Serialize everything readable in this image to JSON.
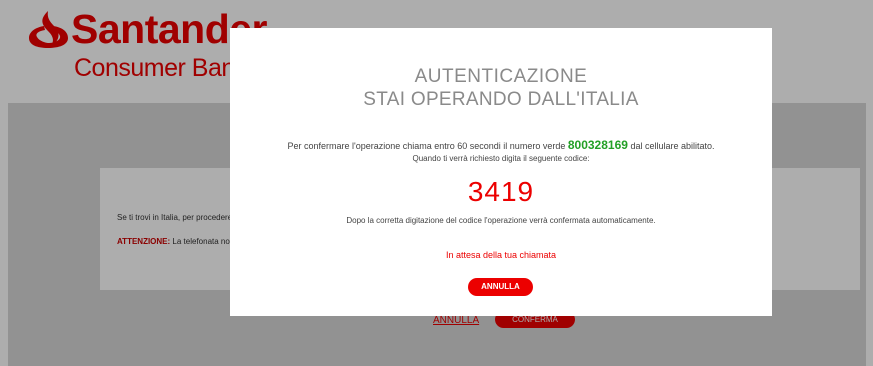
{
  "header": {
    "brand": "Santander",
    "sub": "Consumer Bank"
  },
  "background": {
    "text1": "Se ti trovi in Italia, per procedere",
    "attention_label": "ATTENZIONE:",
    "text2": "La telefonata non",
    "annulla": "ANNULLA",
    "conferma": "CONFERMA"
  },
  "modal": {
    "title1": "AUTENTICAZIONE",
    "title2": "STAI OPERANDO DALL'ITALIA",
    "line1_prefix": "Per confermare l'operazione chiama entro 60 secondi il numero verde",
    "phone_number": "800328169",
    "line1_suffix": "dal cellulare abilitato.",
    "line2": "Quando ti verrà richiesto digita il seguente codice:",
    "code": "3419",
    "line3": "Dopo la corretta digitazione del codice l'operazione verrà confermata automaticamente.",
    "waiting": "In attesa della tua chiamata",
    "cancel_button": "ANNULLA"
  },
  "colors": {
    "brand_red": "#ec0000",
    "phone_green": "#22a026"
  },
  "icons": {
    "logo": "santander-flame-icon"
  }
}
